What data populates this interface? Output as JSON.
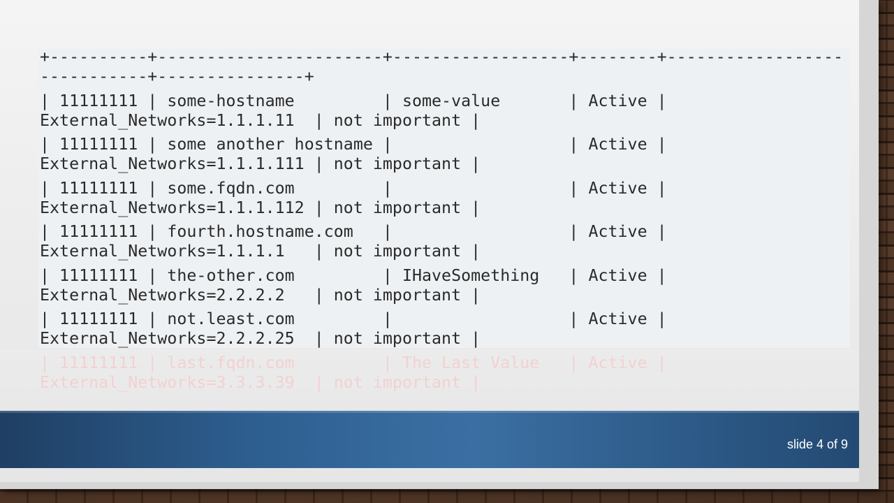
{
  "code": {
    "border_line_1": "+----------+-----------------------+------------------+--------+------------------",
    "border_line_2": "-----------+---------------+",
    "rows": [
      {
        "line1": "| 11111111 | some-hostname         | some-value       | Active |",
        "line2": "External_Networks=1.1.1.11  | not important |"
      },
      {
        "line1": "| 11111111 | some another hostname |                  | Active |",
        "line2": "External_Networks=1.1.1.111 | not important |"
      },
      {
        "line1": "| 11111111 | some.fqdn.com         |                  | Active |",
        "line2": "External_Networks=1.1.1.112 | not important |"
      },
      {
        "line1": "| 11111111 | fourth.hostname.com   |                  | Active |",
        "line2": "External_Networks=1.1.1.1   | not important |"
      },
      {
        "line1": "| 11111111 | the-other.com         | IHaveSomething   | Active |",
        "line2": "External_Networks=2.2.2.2   | not important |"
      },
      {
        "line1": "| 11111111 | not.least.com         |                  | Active |",
        "line2": "External_Networks=2.2.2.25  | not important |"
      }
    ],
    "faded_row": {
      "line1": "| 11111111 | last.fqdn.com         | The Last Value   | Active |",
      "line2": "External_Networks=3.3.3.39  | not important |"
    }
  },
  "footer": {
    "slide_counter": "slide 4 of 9"
  }
}
